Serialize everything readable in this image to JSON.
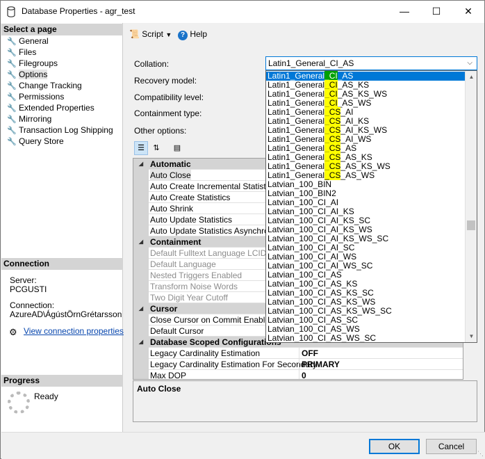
{
  "window": {
    "title": "Database Properties - agr_test"
  },
  "left": {
    "select_header": "Select a page",
    "pages": [
      "General",
      "Files",
      "Filegroups",
      "Options",
      "Change Tracking",
      "Permissions",
      "Extended Properties",
      "Mirroring",
      "Transaction Log Shipping",
      "Query Store"
    ],
    "connection_header": "Connection",
    "server_label": "Server:",
    "server_value": "PCGUSTI",
    "connection_label": "Connection:",
    "connection_value": "AzureAD\\ÁgústÖrnGrétarsson",
    "view_link": "View connection properties",
    "progress_header": "Progress",
    "progress_status": "Ready"
  },
  "toolbar": {
    "script_label": "Script",
    "help_label": "Help"
  },
  "form": {
    "collation_label": "Collation:",
    "collation_value": "Latin1_General_CI_AS",
    "recovery_label": "Recovery model:",
    "compat_label": "Compatibility level:",
    "containment_label": "Containment type:",
    "other_label": "Other options:"
  },
  "grid": {
    "rows": [
      {
        "kind": "cat",
        "name": "Automatic",
        "value": ""
      },
      {
        "kind": "prop",
        "name": "Auto Close",
        "value": "",
        "selected": true
      },
      {
        "kind": "prop",
        "name": "Auto Create Incremental Statistics",
        "value": ""
      },
      {
        "kind": "prop",
        "name": "Auto Create Statistics",
        "value": ""
      },
      {
        "kind": "prop",
        "name": "Auto Shrink",
        "value": ""
      },
      {
        "kind": "prop",
        "name": "Auto Update Statistics",
        "value": ""
      },
      {
        "kind": "prop",
        "name": "Auto Update Statistics Asynchronously",
        "value": ""
      },
      {
        "kind": "cat",
        "name": "Containment",
        "value": ""
      },
      {
        "kind": "prop",
        "name": "Default Fulltext Language LCID",
        "value": "",
        "disabled": true
      },
      {
        "kind": "prop",
        "name": "Default Language",
        "value": "",
        "disabled": true
      },
      {
        "kind": "prop",
        "name": "Nested Triggers Enabled",
        "value": "",
        "disabled": true
      },
      {
        "kind": "prop",
        "name": "Transform Noise Words",
        "value": "",
        "disabled": true
      },
      {
        "kind": "prop",
        "name": "Two Digit Year Cutoff",
        "value": "",
        "disabled": true
      },
      {
        "kind": "cat",
        "name": "Cursor",
        "value": ""
      },
      {
        "kind": "prop",
        "name": "Close Cursor on Commit Enabled",
        "value": ""
      },
      {
        "kind": "prop",
        "name": "Default Cursor",
        "value": ""
      },
      {
        "kind": "cat",
        "name": "Database Scoped Configurations",
        "value": ""
      },
      {
        "kind": "prop",
        "name": "Legacy Cardinality Estimation",
        "value": "OFF"
      },
      {
        "kind": "prop",
        "name": "Legacy Cardinality Estimation For Secondary",
        "value": "PRIMARY"
      },
      {
        "kind": "prop",
        "name": "Max DOP",
        "value": "0"
      }
    ],
    "description_title": "Auto Close"
  },
  "dropdown": {
    "items": [
      {
        "pre": "Latin1_General",
        "hl": "_CI",
        "post": "_AS",
        "selected": true
      },
      {
        "pre": "Latin1_General",
        "hl": "_CI",
        "post": "_AS_KS"
      },
      {
        "pre": "Latin1_General",
        "hl": "_CI",
        "post": "_AS_KS_WS"
      },
      {
        "pre": "Latin1_General",
        "hl": "_CI",
        "post": "_AS_WS"
      },
      {
        "pre": "Latin1_General",
        "hl": "_CS",
        "post": "_AI"
      },
      {
        "pre": "Latin1_General",
        "hl": "_CS",
        "post": "_AI_KS"
      },
      {
        "pre": "Latin1_General",
        "hl": "_CS",
        "post": "_AI_KS_WS"
      },
      {
        "pre": "Latin1_General",
        "hl": "_CS",
        "post": "_AI_WS"
      },
      {
        "pre": "Latin1_General",
        "hl": "_CS",
        "post": "_AS"
      },
      {
        "pre": "Latin1_General",
        "hl": "_CS",
        "post": "_AS_KS"
      },
      {
        "pre": "Latin1_General",
        "hl": "_CS",
        "post": "_AS_KS_WS"
      },
      {
        "pre": "Latin1_General",
        "hl": "_CS",
        "post": "_AS_WS"
      },
      {
        "pre": "Latvian_100_BIN",
        "hl": "",
        "post": ""
      },
      {
        "pre": "Latvian_100_BIN2",
        "hl": "",
        "post": ""
      },
      {
        "pre": "Latvian_100_CI_AI",
        "hl": "",
        "post": ""
      },
      {
        "pre": "Latvian_100_CI_AI_KS",
        "hl": "",
        "post": ""
      },
      {
        "pre": "Latvian_100_CI_AI_KS_SC",
        "hl": "",
        "post": ""
      },
      {
        "pre": "Latvian_100_CI_AI_KS_WS",
        "hl": "",
        "post": ""
      },
      {
        "pre": "Latvian_100_CI_AI_KS_WS_SC",
        "hl": "",
        "post": ""
      },
      {
        "pre": "Latvian_100_CI_AI_SC",
        "hl": "",
        "post": ""
      },
      {
        "pre": "Latvian_100_CI_AI_WS",
        "hl": "",
        "post": ""
      },
      {
        "pre": "Latvian_100_CI_AI_WS_SC",
        "hl": "",
        "post": ""
      },
      {
        "pre": "Latvian_100_CI_AS",
        "hl": "",
        "post": ""
      },
      {
        "pre": "Latvian_100_CI_AS_KS",
        "hl": "",
        "post": ""
      },
      {
        "pre": "Latvian_100_CI_AS_KS_SC",
        "hl": "",
        "post": ""
      },
      {
        "pre": "Latvian_100_CI_AS_KS_WS",
        "hl": "",
        "post": ""
      },
      {
        "pre": "Latvian_100_CI_AS_KS_WS_SC",
        "hl": "",
        "post": ""
      },
      {
        "pre": "Latvian_100_CI_AS_SC",
        "hl": "",
        "post": ""
      },
      {
        "pre": "Latvian_100_CI_AS_WS",
        "hl": "",
        "post": ""
      },
      {
        "pre": "Latvian_100_CI_AS_WS_SC",
        "hl": "",
        "post": ""
      }
    ]
  },
  "footer": {
    "ok_label": "OK",
    "cancel_label": "Cancel"
  }
}
